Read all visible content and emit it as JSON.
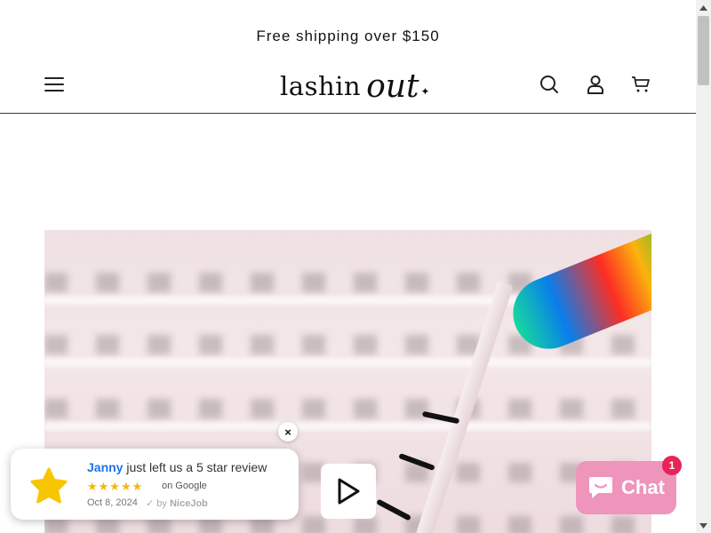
{
  "announcement": {
    "text": "Free shipping over $150"
  },
  "header": {
    "logo_primary": "lashin",
    "logo_secondary": "out",
    "icons": [
      "menu-icon",
      "search-icon",
      "account-icon",
      "cart-icon"
    ]
  },
  "hero": {
    "play_icon": "play-icon"
  },
  "review": {
    "name": "Janny",
    "text": " just left us a 5 star review",
    "stars": "★★★★★",
    "source": "on Google",
    "date": "Oct 8, 2024",
    "by_prefix": "by ",
    "by_brand": "NiceJob",
    "close_label": "×"
  },
  "chat": {
    "label": "Chat",
    "badge": "1",
    "color": "#ef94bb",
    "badge_color": "#e8235a"
  },
  "colors": {
    "text": "#121212",
    "review_link": "#1a73e8",
    "star": "#f6b60b"
  }
}
